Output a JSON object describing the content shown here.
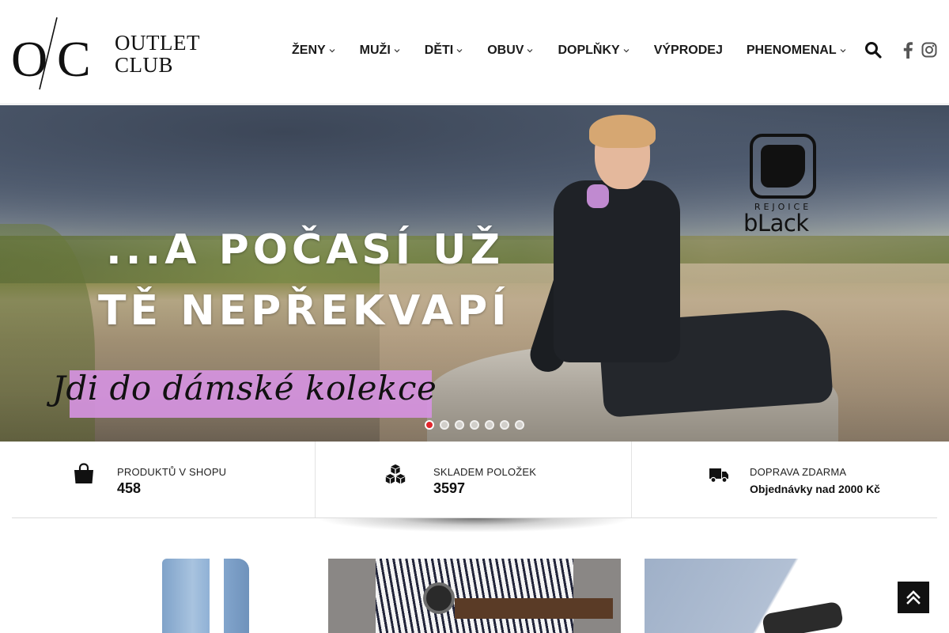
{
  "header": {
    "logo": {
      "mark": "O/C",
      "line1": "OUTLET",
      "line2": "CLUB"
    },
    "nav": [
      {
        "label": "ŽENY",
        "has_dropdown": true
      },
      {
        "label": "MUŽI",
        "has_dropdown": true
      },
      {
        "label": "DĚTI",
        "has_dropdown": true
      },
      {
        "label": "OBUV",
        "has_dropdown": true
      },
      {
        "label": "DOPLŇKY",
        "has_dropdown": true
      },
      {
        "label": "VÝPRODEJ",
        "has_dropdown": false
      },
      {
        "label": "PHENOMENAL",
        "has_dropdown": true
      }
    ],
    "icons": {
      "search": "search-icon",
      "facebook": "facebook-icon",
      "instagram": "instagram-icon"
    }
  },
  "hero": {
    "line1": "...A POČASÍ UŽ",
    "line2": "TĚ NEPŘEKVAPÍ",
    "cta": "Jdi do dámské kolekce",
    "cta_color": "#d592df",
    "brand": {
      "small": "REJOICE",
      "big": "bLack"
    },
    "slides_count": 7,
    "active_slide": 1,
    "active_dot_color": "#e1262c"
  },
  "info": [
    {
      "icon": "shopping-bag-icon",
      "label": "PRODUKTŮ V SHOPU",
      "value": "458"
    },
    {
      "icon": "boxes-icon",
      "label": "SKLADEM POLOŽEK",
      "value": "3597"
    },
    {
      "icon": "truck-icon",
      "label": "DOPRAVA ZDARMA",
      "value": "Objednávky nad 2000 Kč"
    }
  ],
  "scroll_top": {
    "icon": "double-chevron-up-icon"
  }
}
